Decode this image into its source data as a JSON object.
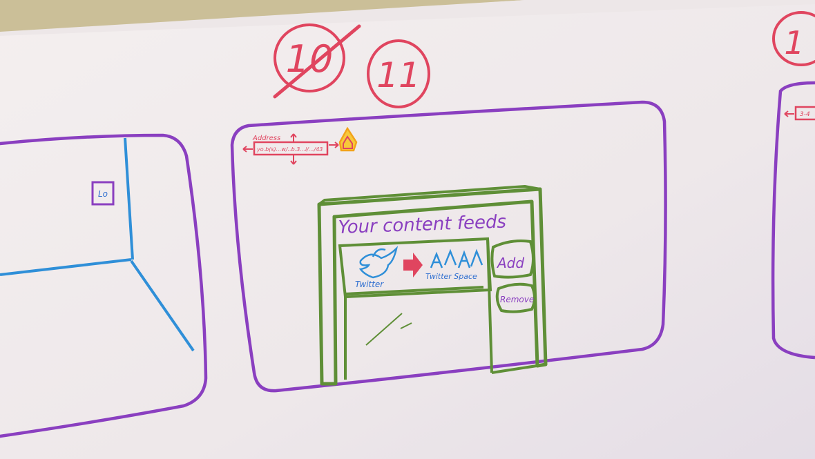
{
  "frame_numbers": {
    "crossed_out": "10",
    "current": "11",
    "next_partial": "1"
  },
  "left_frame": {
    "box_label": "Lo"
  },
  "center_frame": {
    "address_bar": {
      "label": "Address",
      "value": "yo.b(s)...w/..b.3...i/.../43"
    },
    "home_icon": "home-icon",
    "feeds_panel": {
      "title": "Your content feeds",
      "feed_item": {
        "source_label": "Twitter",
        "target_label": "Twitter Space",
        "source_icon": "bird-icon",
        "arrow_icon": "right-arrow-icon",
        "target_icon": "people-icon"
      },
      "add_button": "Add",
      "remove_button": "Remove"
    }
  },
  "right_frame": {
    "address_fragment": "3-4"
  },
  "colors": {
    "whiteboard": "#efe9ea",
    "purple_marker": "#8a3fc0",
    "green_marker": "#5f8f37",
    "blue_marker": "#2f8fd8",
    "red_marker": "#e0455f",
    "orange_marker": "#f2a31b"
  }
}
